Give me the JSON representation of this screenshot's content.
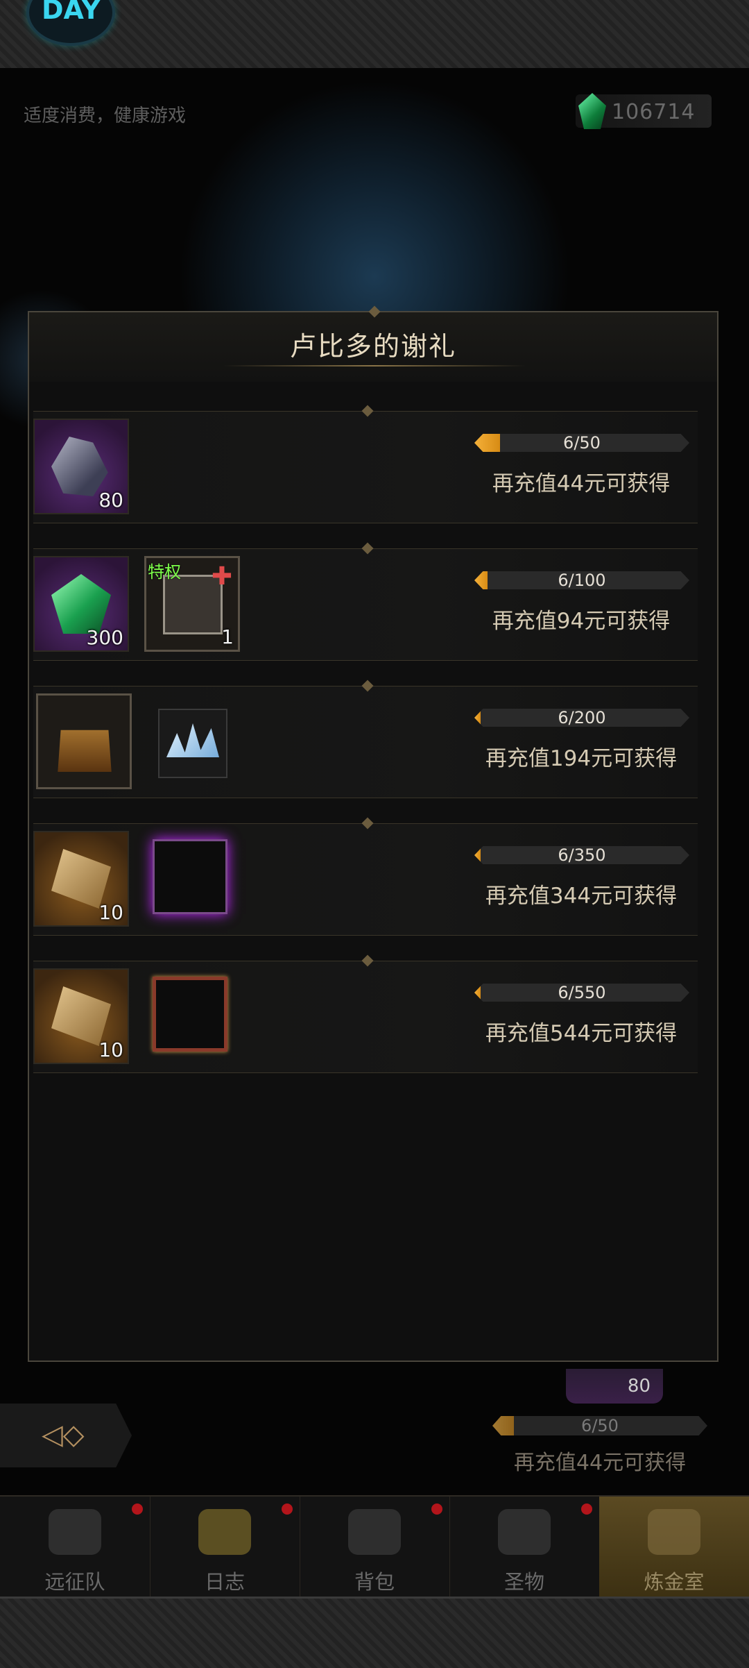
{
  "topbar": {
    "logo_text": "DAY"
  },
  "notice": "适度消费，健康游戏",
  "currency": {
    "icon": "green-gem-icon",
    "value": "106714"
  },
  "modal": {
    "title": "卢比多的谢礼"
  },
  "rewards": [
    {
      "items": [
        {
          "icon": "ore-icon",
          "count": "80",
          "rarity": "purple"
        }
      ],
      "progress_text": "6/50",
      "progress": 0.12,
      "condition": "再充值44元可获得"
    },
    {
      "items": [
        {
          "icon": "green-gem-icon",
          "count": "300",
          "rarity": "purple"
        },
        {
          "icon": "avatar-frame-icon",
          "count": "1",
          "badge": "特权"
        }
      ],
      "progress_text": "6/100",
      "progress": 0.06,
      "condition": "再充值94元可获得"
    },
    {
      "items": [
        {
          "icon": "treasure-chest-icon",
          "count": ""
        },
        {
          "icon": "ice-crystal-icon",
          "count": ""
        }
      ],
      "progress_text": "6/200",
      "progress": 0.03,
      "condition": "再充值194元可获得"
    },
    {
      "items": [
        {
          "icon": "scroll-icon",
          "count": "10",
          "rarity": "orange"
        },
        {
          "icon": "purple-portrait-frame-icon",
          "count": ""
        }
      ],
      "progress_text": "6/350",
      "progress": 0.017,
      "condition": "再充值344元可获得"
    },
    {
      "items": [
        {
          "icon": "scroll-icon",
          "count": "10",
          "rarity": "orange"
        },
        {
          "icon": "ornate-portrait-frame-icon",
          "count": ""
        }
      ],
      "progress_text": "6/550",
      "progress": 0.011,
      "condition": "再充值544元可获得"
    }
  ],
  "background_panel": {
    "item_count": "80",
    "progress_text": "6/50",
    "condition": "再充值44元可获得"
  },
  "nav": [
    {
      "label": "远征队",
      "icon": "viking-helmet-icon",
      "badge": true
    },
    {
      "label": "日志",
      "icon": "journal-icon",
      "badge": true
    },
    {
      "label": "背包",
      "icon": "backpack-icon",
      "badge": true
    },
    {
      "label": "圣物",
      "icon": "relic-icon",
      "badge": true
    },
    {
      "label": "炼金室",
      "icon": "alchemy-icon",
      "badge": false,
      "active": true
    }
  ]
}
